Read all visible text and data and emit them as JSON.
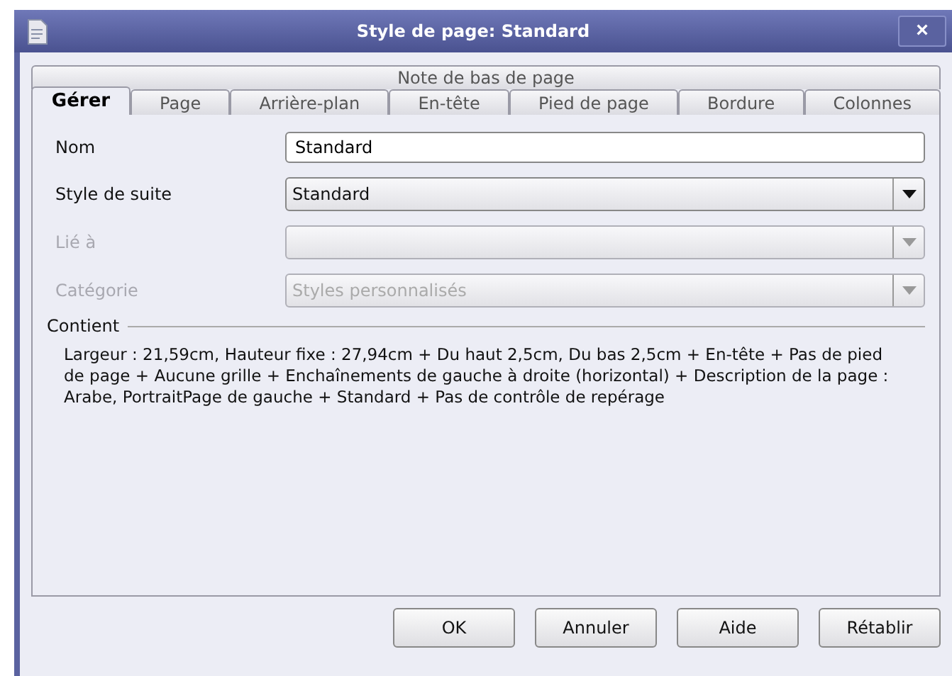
{
  "window": {
    "title": "Style de page: Standard",
    "close": "×"
  },
  "tabs_top": [
    {
      "label": "Note de bas de page",
      "selected": false
    }
  ],
  "tabs": [
    {
      "label": "Gérer",
      "selected": true
    },
    {
      "label": "Page",
      "selected": false
    },
    {
      "label": "Arrière-plan",
      "selected": false
    },
    {
      "label": "En-tête",
      "selected": false
    },
    {
      "label": "Pied de page",
      "selected": false
    },
    {
      "label": "Bordure",
      "selected": false
    },
    {
      "label": "Colonnes",
      "selected": false
    }
  ],
  "fields": [
    {
      "label": "Nom",
      "kind": "text",
      "value": "Standard",
      "disabled": false
    },
    {
      "label": "Style de suite",
      "kind": "dropdown",
      "value": "Standard",
      "disabled": false
    },
    {
      "label": "Lié à",
      "kind": "dropdown",
      "disabled": true
    },
    {
      "label": "Catégorie",
      "kind": "dropdown",
      "value": "Styles personnalisés",
      "disabled": true
    }
  ],
  "contains": {
    "title": "Contient",
    "text": "Largeur : 21,59cm, Hauteur fixe : 27,94cm + Du haut 2,5cm, Du bas 2,5cm + En-tête + Pas de pied de page + Aucune grille + Enchaînements de gauche à droite (horizontal) + Description de la page : Arabe, PortraitPage de gauche + Standard + Pas de contrôle de repérage"
  },
  "buttons": [
    "OK",
    "Annuler",
    "Aide",
    "Rétablir"
  ]
}
